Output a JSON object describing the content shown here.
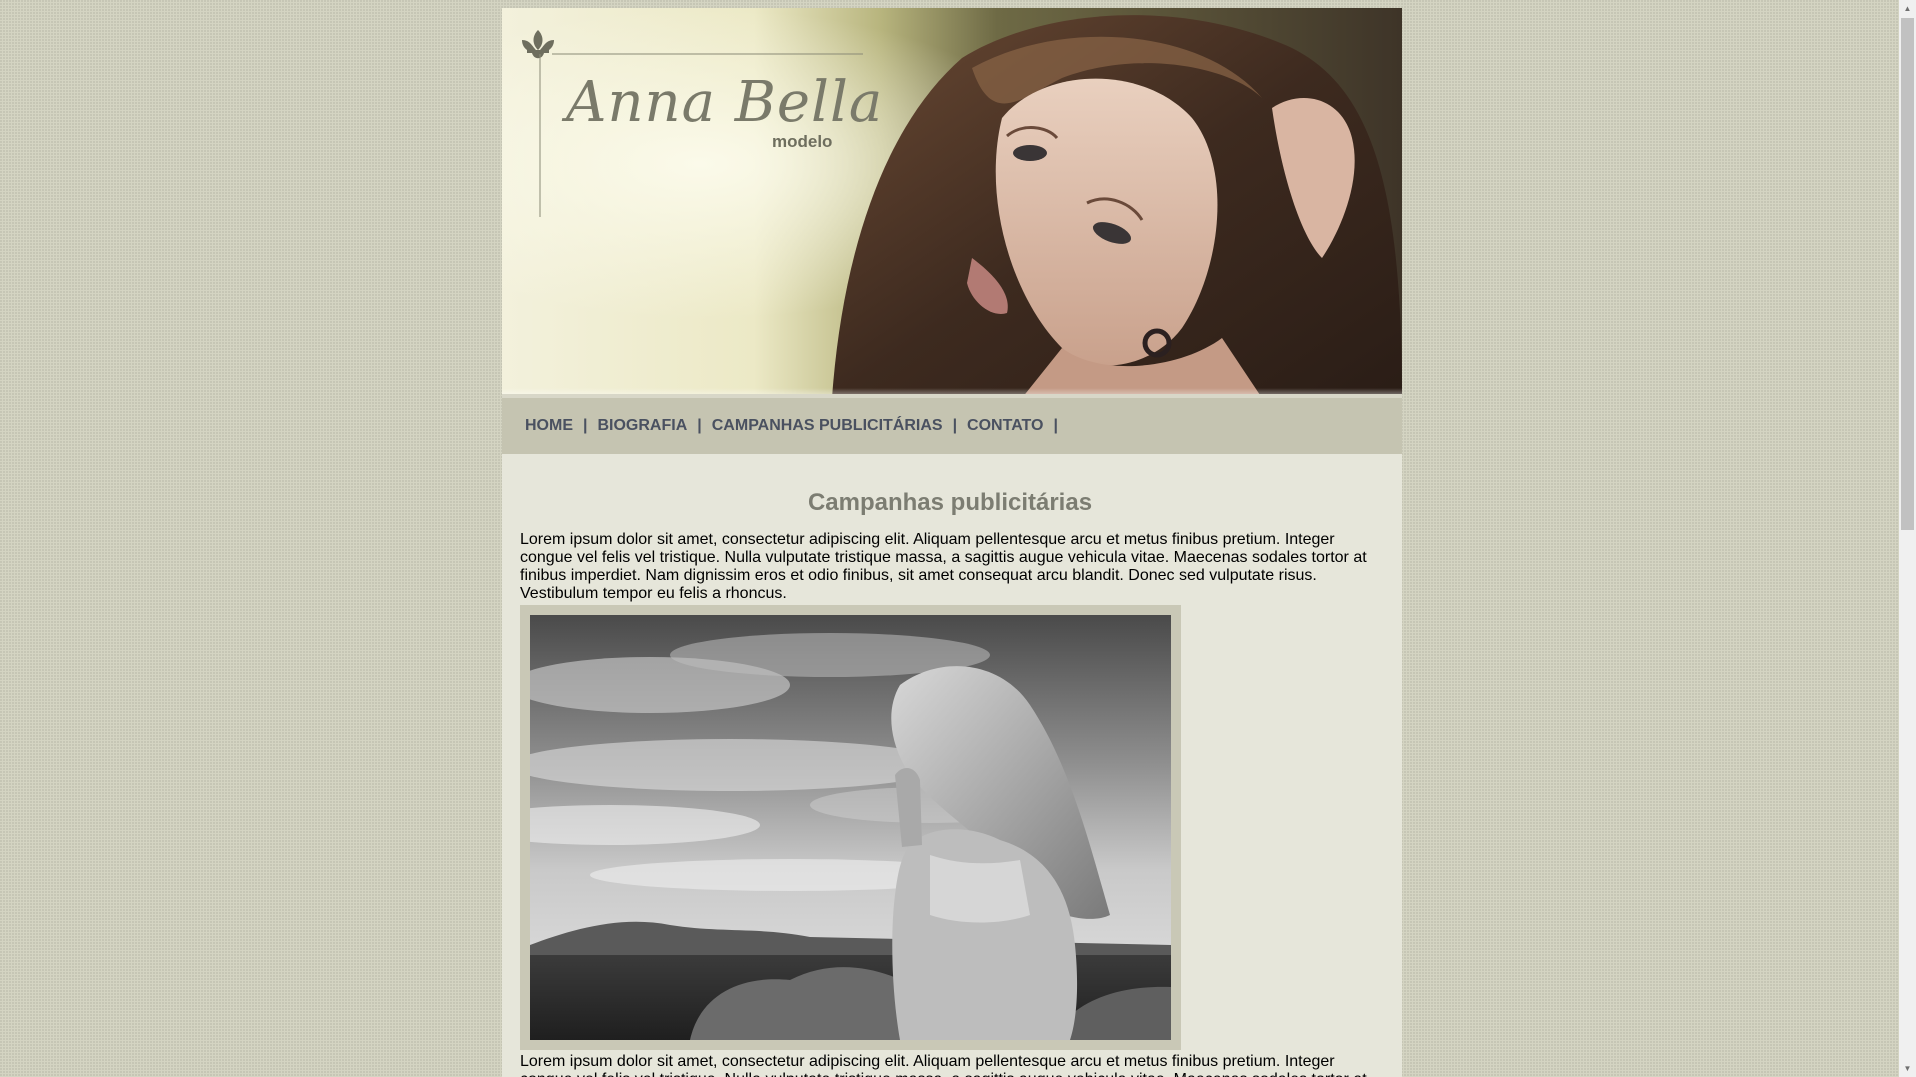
{
  "site": {
    "brand_name": "Anna Bella",
    "brand_tagline": "modelo"
  },
  "nav": {
    "items": [
      {
        "label": "HOME"
      },
      {
        "label": "BIOGRAFIA"
      },
      {
        "label": "CAMPANHAS PUBLICITÁRIAS"
      },
      {
        "label": "CONTATO"
      }
    ],
    "separator": "|"
  },
  "main": {
    "title": "Campanhas publicitárias",
    "paragraph_1": "Lorem ipsum dolor sit amet, consectetur adipiscing elit. Aliquam pellentesque arcu et metus finibus pretium. Integer congue vel felis vel tristique. Nulla vulputate tristique massa, a sagittis augue vehicula vitae. Maecenas sodales tortor at finibus imperdiet. Nam dignissim eros et odio finibus, sit amet consequat arcu blandit. Donec sed vulputate risus. Vestibulum tempor eu felis a rhoncus.",
    "paragraph_2": "Lorem ipsum dolor sit amet, consectetur adipiscing elit. Aliquam pellentesque arcu et metus finibus pretium. Integer congue vel felis vel tristique. Nulla vulputate tristique massa, a sagittis augue vehicula vitae. Maecenas sodales tortor at finibus imperdiet."
  },
  "colors": {
    "page_background": "#d4d4c2",
    "content_background": "#e6e6da",
    "nav_background": "#c5c4b1",
    "nav_text": "#4a5160",
    "title_text": "#7c7d72",
    "photo_frame": "#c9c8b6"
  },
  "icons": {
    "logo_ornament": "fleur-de-lis-icon",
    "scroll_up": "triangle-up-icon",
    "scroll_down": "triangle-down-icon"
  }
}
